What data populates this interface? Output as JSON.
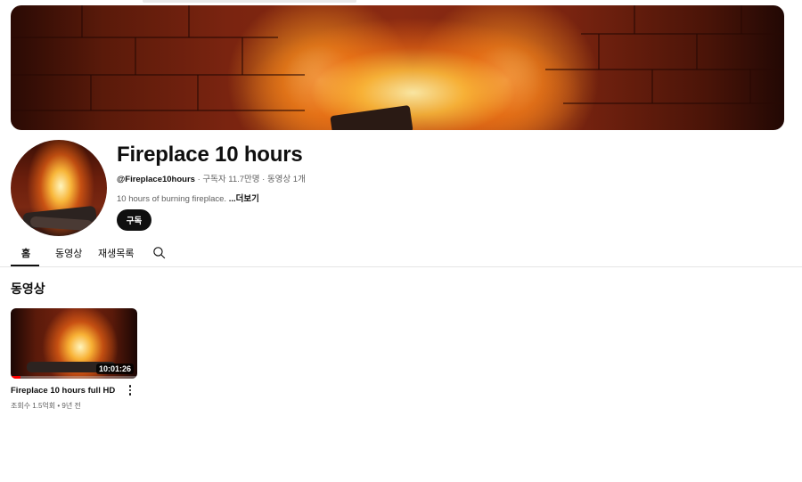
{
  "channel": {
    "title": "Fireplace 10 hours",
    "handle": "@Fireplace10hours",
    "meta_rest": " · 구독자 11.7만명 · 동영상 1개",
    "description": "10 hours of burning fireplace. ",
    "more_label": "...더보기",
    "subscribe_label": "구독"
  },
  "tabs": [
    {
      "label": "홈",
      "active": true
    },
    {
      "label": "동영상",
      "active": false
    },
    {
      "label": "재생목록",
      "active": false
    }
  ],
  "section": {
    "title": "동영상"
  },
  "videos": [
    {
      "title": "Fireplace 10 hours full HD",
      "duration": "10:01:26",
      "meta": "조회수 1.5억회 • 9년 전",
      "watch_progress": 0.08
    }
  ],
  "colors": {
    "accent": "#0f0f0f",
    "progress": "#ff0000",
    "muted_text": "#606060"
  },
  "icons": {
    "search": "search-icon",
    "more": "more-vert-icon"
  }
}
